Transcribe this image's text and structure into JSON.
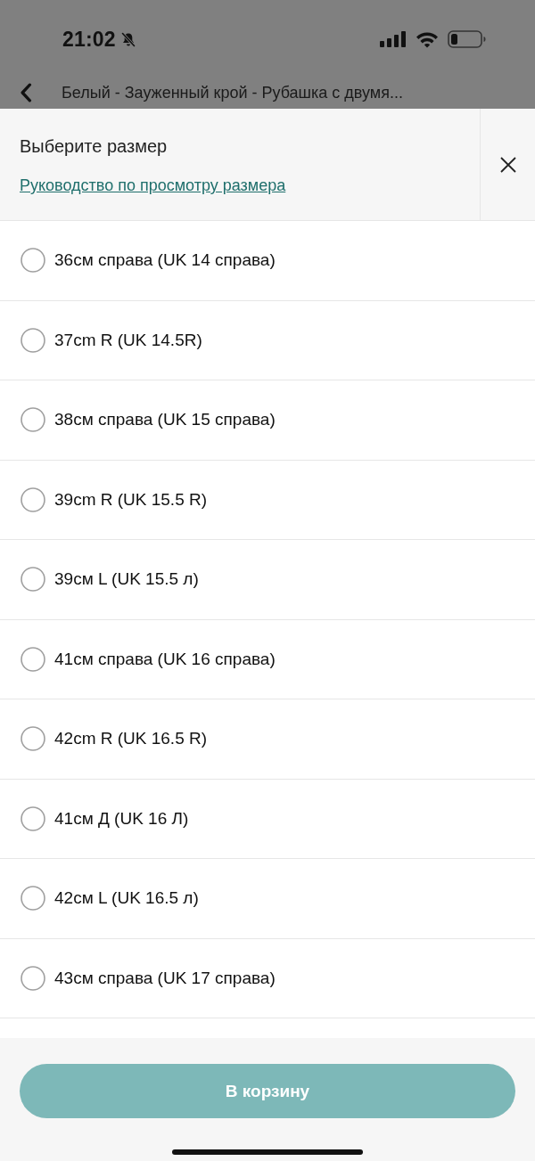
{
  "status_bar": {
    "time": "21:02",
    "silent": true
  },
  "page": {
    "title": "Белый - Зауженный крой - Рубашка с двумя..."
  },
  "sheet": {
    "title": "Выберите размер",
    "guide_link": "Руководство по просмотру размера"
  },
  "sizes": [
    {
      "label": "36см справа (UK 14 справа)",
      "selected": false
    },
    {
      "label": "37cm R (UK 14.5R)",
      "selected": false
    },
    {
      "label": "38см справа (UK 15 справа)",
      "selected": false
    },
    {
      "label": "39cm R (UK 15.5 R)",
      "selected": false
    },
    {
      "label": "39см L (UK 15.5 л)",
      "selected": false
    },
    {
      "label": "41см справа (UK 16 справа)",
      "selected": false
    },
    {
      "label": "42cm R (UK 16.5 R)",
      "selected": false
    },
    {
      "label": "41см Д (UK 16 Л)",
      "selected": false
    },
    {
      "label": "42см L (UK 16.5 л)",
      "selected": false
    },
    {
      "label": "43см справа (UK 17 справа)",
      "selected": false
    }
  ],
  "cart_button": {
    "label": "В корзину",
    "disabled": true
  }
}
